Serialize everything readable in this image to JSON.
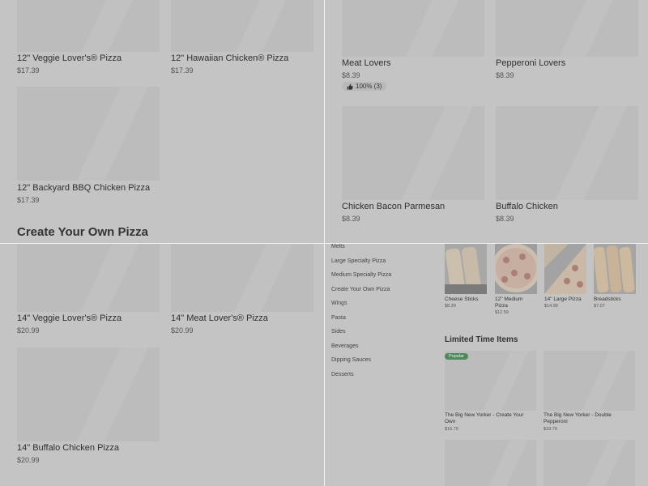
{
  "top_left": {
    "items": [
      {
        "name": "12\" Veggie Lover's® Pizza",
        "price": "$17.39"
      },
      {
        "name": "12\" Hawaiian Chicken® Pizza",
        "price": "$17.39"
      },
      {
        "name": "12\" Backyard BBQ Chicken Pizza",
        "price": "$17.39"
      }
    ],
    "section_title": "Create Your Own Pizza"
  },
  "top_right": {
    "items": [
      {
        "name": "Meat Lovers",
        "price": "$8.39"
      },
      {
        "name": "Pepperoni Lovers",
        "price": "$8.39"
      },
      {
        "name": "Chicken Bacon Parmesan",
        "price": "$8.39"
      },
      {
        "name": "Buffalo Chicken",
        "price": "$8.39"
      }
    ],
    "rating_badge": "100% (3)"
  },
  "bottom_left": {
    "items": [
      {
        "name": "14\" Veggie Lover's® Pizza",
        "price": "$20.99"
      },
      {
        "name": "14\" Meat Lover's® Pizza",
        "price": "$20.99"
      },
      {
        "name": "14\" Buffalo Chicken Pizza",
        "price": "$20.99"
      }
    ]
  },
  "bottom_right": {
    "nav": [
      "Melts",
      "Large Specialty Pizza",
      "Medium Specialty Pizza",
      "Create Your Own Pizza",
      "Wings",
      "Pasta",
      "Sides",
      "Beverages",
      "Dipping Sauces",
      "Desserts"
    ],
    "featured": [
      {
        "name": "Cheese Sticks",
        "price": "$8.39"
      },
      {
        "name": "12\" Medium Pizza",
        "price": "$12.59"
      },
      {
        "name": "14\" Large Pizza",
        "price": "$14.99"
      },
      {
        "name": "Breadsticks",
        "price": "$7.07"
      }
    ],
    "limited_title": "Limited Time Items",
    "popular_tag": "Popular",
    "limited": [
      {
        "name": "The Big New Yorker - Create Your Own",
        "price": "$16.79"
      },
      {
        "name": "The Big New Yorker - Double Pepperoni",
        "price": "$18.79"
      }
    ]
  },
  "colors": {
    "overlay_bg": "#c4c4c4",
    "popular_tag": "#4c8a5c"
  }
}
